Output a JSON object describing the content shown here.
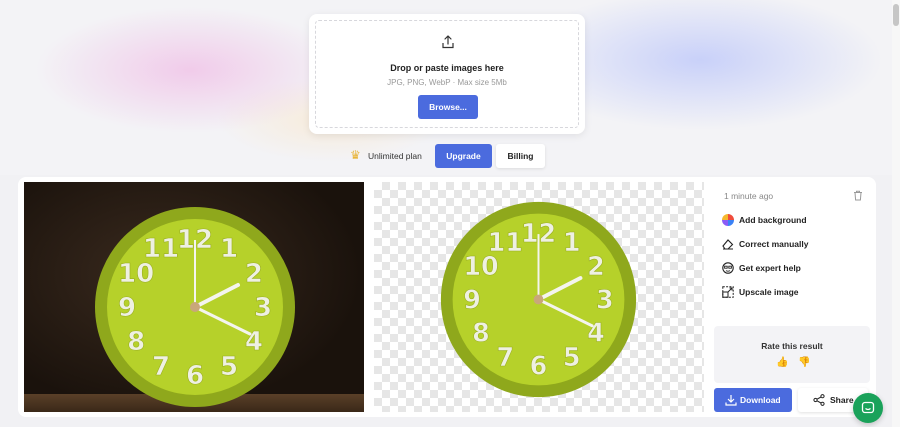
{
  "upload": {
    "title": "Drop or paste images here",
    "subtitle": "JPG, PNG, WebP · Max size 5Mb",
    "browse_label": "Browse...",
    "icon": "upload-icon"
  },
  "plan": {
    "icon": "crown-icon",
    "label": "Unlimited plan",
    "upgrade_label": "Upgrade",
    "billing_label": "Billing"
  },
  "result": {
    "timestamp": "1 minute ago",
    "actions": [
      {
        "label": "Add background",
        "icon": "color-wheel-icon"
      },
      {
        "label": "Correct manually",
        "icon": "eraser-icon"
      },
      {
        "label": "Get expert help",
        "icon": "expert-icon"
      },
      {
        "label": "Upscale image",
        "icon": "upscale-icon"
      }
    ],
    "rate_title": "Rate this result",
    "download_label": "Download",
    "share_label": "Share"
  },
  "clock": {
    "numbers": [
      "12",
      "1",
      "2",
      "3",
      "4",
      "5",
      "6",
      "7",
      "8",
      "9",
      "10",
      "11"
    ]
  },
  "colors": {
    "accent": "#4b6bde",
    "clock_face": "#b6d12a",
    "chat": "#1aa25a"
  }
}
